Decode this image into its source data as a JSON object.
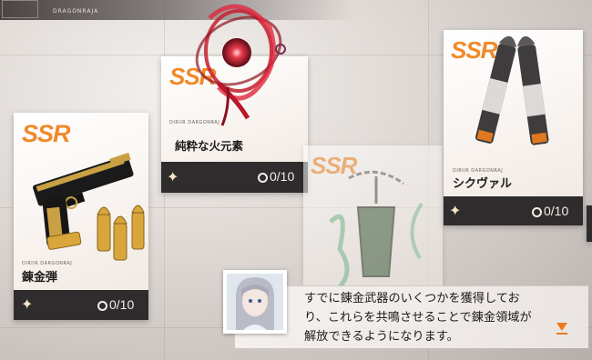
{
  "header": {
    "brand": "DRAGONRAJA"
  },
  "cards": [
    {
      "rarity": "SSR",
      "code": "DIRIIR DARGONRAJ",
      "name": "錬金弾",
      "count": "0/10",
      "item": "golden-pistol-and-bullets"
    },
    {
      "rarity": "SSR",
      "code": "DIRIIR DARGONRAJ",
      "name": "純粋な火元素",
      "count": "0/10",
      "item": "red-fire-element-orb"
    },
    {
      "rarity": "SSR",
      "code": "",
      "name": "",
      "count": "",
      "item": "green-crystal-chain-pendant"
    },
    {
      "rarity": "SSR",
      "code": "DIRIIR DARGONRAJ",
      "name": "シクヴァル",
      "count": "0/10",
      "item": "twin-rocket-torpedoes"
    }
  ],
  "dialog": {
    "text_lines": [
      "すでに錬金武器のいくつかを獲得してお",
      "り、これらを共鳴させることで錬金領域が",
      "解放できるようになります。"
    ],
    "next_icon": "orange-down-triangle-icon"
  },
  "colors": {
    "accent": "#f08a2a",
    "footer": "#2e2c2c",
    "next": "#ee7a1c"
  }
}
